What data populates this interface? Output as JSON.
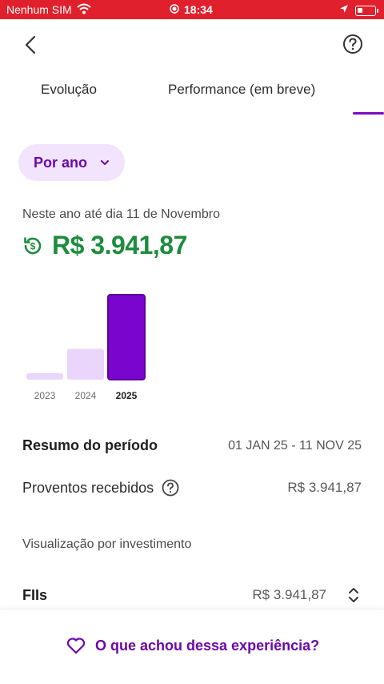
{
  "status_bar": {
    "carrier": "Nenhum SIM",
    "time": "18:34"
  },
  "tabs": [
    {
      "label": "Evolução"
    },
    {
      "label": "Performance (em breve)"
    }
  ],
  "filter": {
    "label": "Por ano"
  },
  "period": {
    "caption": "Neste ano até dia 11 de Novembro",
    "total": "R$ 3.941,87"
  },
  "chart_data": {
    "type": "bar",
    "categories": [
      "2023",
      "2024",
      "2025"
    ],
    "values": [
      40,
      1430,
      3941.87
    ],
    "selected": "2025",
    "colors": {
      "unselected": "#ead5fb",
      "selected": "#7a05cc",
      "selected_border": "#5e0399"
    },
    "ylim": [
      0,
      3941.87
    ]
  },
  "summary": {
    "title": "Resumo do período",
    "range": "01 JAN 25 - 11 NOV 25"
  },
  "proventos": {
    "label": "Proventos recebidos",
    "value": "R$ 3.941,87"
  },
  "visualizacao": {
    "caption": "Visualização por investimento"
  },
  "fii": {
    "label": "FIIs",
    "value": "R$ 3.941,87"
  },
  "feedback": {
    "label": "O que achou dessa experiência?"
  },
  "colors": {
    "accent": "#7a0bc0",
    "positive": "#1e8c3e",
    "status_bar": "#e0202c"
  }
}
